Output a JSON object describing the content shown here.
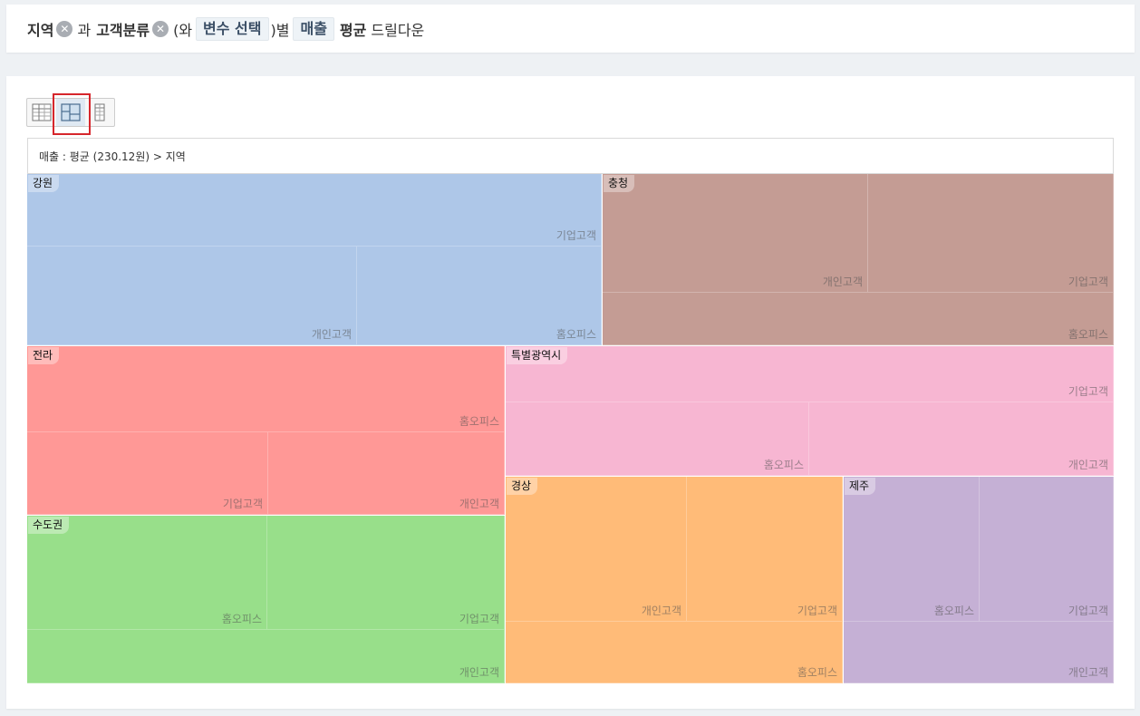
{
  "query": {
    "variable1": "지역",
    "conjunction": "과",
    "variable2": "고객분류",
    "paren_open": "(와",
    "select_variable": "변수 선택",
    "paren_close": ")별",
    "measure": "매출",
    "aggregate": "평균",
    "action": "드릴다운"
  },
  "view_toggle": {
    "options": [
      "table-view",
      "treemap-view",
      "pivot-view"
    ],
    "active": "treemap-view"
  },
  "breadcrumb": "매출 : 평균 (230.12원) > 지역",
  "colors": {
    "강원": "#aec7e8",
    "충청": "#c49c94",
    "전라": "#ff9896",
    "특별광역시": "#f7b6d2",
    "수도권": "#98df8a",
    "경상": "#ffbb78",
    "제주": "#c5b0d5"
  },
  "treemap": {
    "regions": [
      {
        "name": "강원",
        "cells": [
          "기업고객",
          "개인고객",
          "홈오피스"
        ]
      },
      {
        "name": "충청",
        "cells": [
          "개인고객",
          "기업고객",
          "홈오피스"
        ]
      },
      {
        "name": "전라",
        "cells": [
          "홈오피스",
          "기업고객",
          "개인고객"
        ]
      },
      {
        "name": "특별광역시",
        "cells": [
          "기업고객",
          "홈오피스",
          "개인고객"
        ]
      },
      {
        "name": "수도권",
        "cells": [
          "홈오피스",
          "기업고객",
          "개인고객"
        ]
      },
      {
        "name": "경상",
        "cells": [
          "개인고객",
          "기업고객",
          "홈오피스"
        ]
      },
      {
        "name": "제주",
        "cells": [
          "홈오피스",
          "기업고객",
          "개인고객"
        ]
      }
    ]
  }
}
